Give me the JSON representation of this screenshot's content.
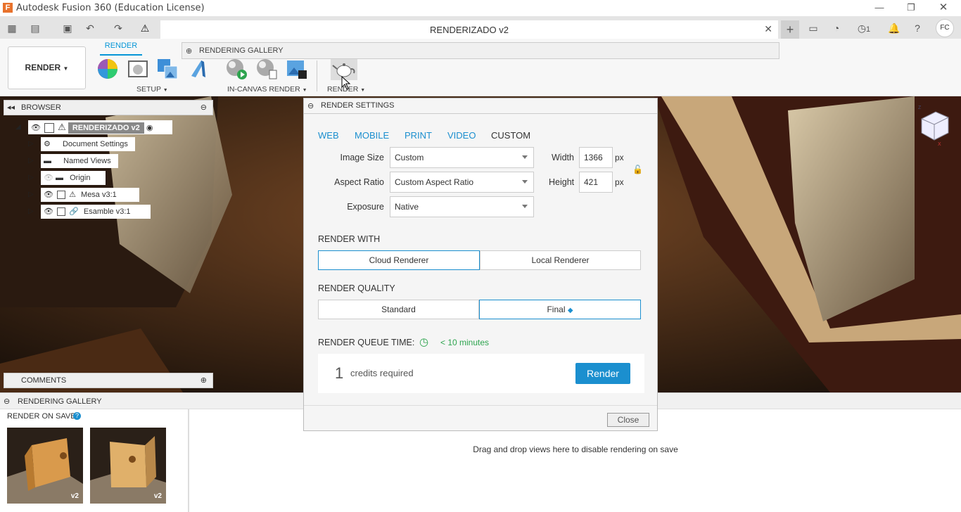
{
  "window": {
    "title": "Autodesk Fusion 360 (Education License)"
  },
  "document_tab": {
    "title": "RENDERIZADO v2"
  },
  "top_right": {
    "jobs_count": "1",
    "user_initials": "FC"
  },
  "toolbar": {
    "workspace": "RENDER",
    "active_tab": "RENDER",
    "groups": [
      "SETUP",
      "IN-CANVAS RENDER",
      "RENDER"
    ],
    "gallery_bar_label": "RENDERING GALLERY"
  },
  "browser": {
    "title": "BROWSER",
    "root": "RENDERIZADO v2",
    "items": [
      "Document Settings",
      "Named Views",
      "Origin",
      "Mesa v3:1",
      "Esamble v3:1"
    ]
  },
  "comments": {
    "title": "COMMENTS"
  },
  "render_settings": {
    "title": "RENDER SETTINGS",
    "presets": [
      "WEB",
      "MOBILE",
      "PRINT",
      "VIDEO",
      "CUSTOM"
    ],
    "image_size_label": "Image Size",
    "image_size_value": "Custom",
    "aspect_ratio_label": "Aspect Ratio",
    "aspect_ratio_value": "Custom Aspect Ratio",
    "exposure_label": "Exposure",
    "exposure_value": "Native",
    "width_label": "Width",
    "width_value": "1366",
    "height_label": "Height",
    "height_value": "421",
    "unit": "px",
    "render_with_title": "RENDER WITH",
    "render_with_options": [
      "Cloud Renderer",
      "Local Renderer"
    ],
    "render_quality_title": "RENDER QUALITY",
    "render_quality_options": [
      "Standard",
      "Final"
    ],
    "queue_time_label": "RENDER QUEUE TIME:",
    "queue_time_value": "< 10 minutes",
    "credits_count": "1",
    "credits_text": "credits required",
    "render_button": "Render",
    "close_button": "Close"
  },
  "gallery": {
    "title": "RENDERING GALLERY",
    "render_on_save": "RENDER ON SAVE",
    "thumb_versions": [
      "v2",
      "v2"
    ],
    "drop_hint": "Drag and drop views here to disable rendering on save"
  },
  "colors": {
    "accent": "#1b8fcf",
    "green": "#2ea44f",
    "warning": "#f5d100"
  }
}
